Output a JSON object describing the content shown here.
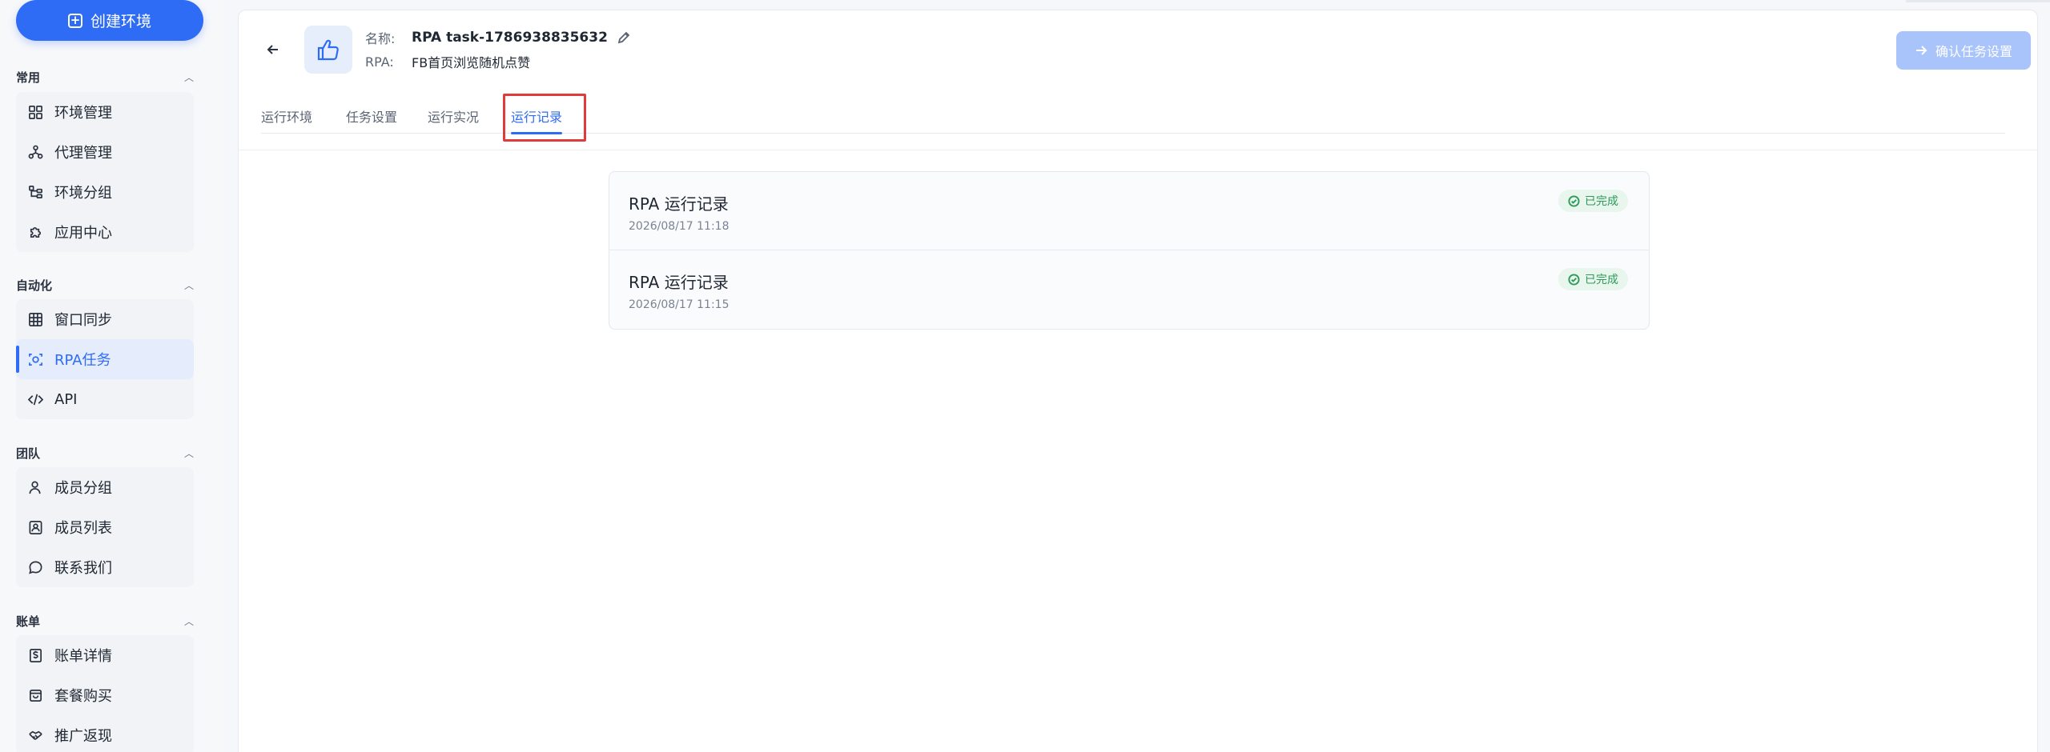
{
  "sidebar": {
    "create_button": "创建环境",
    "groups": [
      {
        "title": "常用",
        "items": [
          {
            "label": "环境管理",
            "icon": "grid-icon"
          },
          {
            "label": "代理管理",
            "icon": "network-icon"
          },
          {
            "label": "环境分组",
            "icon": "tree-icon"
          },
          {
            "label": "应用中心",
            "icon": "puzzle-icon"
          }
        ]
      },
      {
        "title": "自动化",
        "items": [
          {
            "label": "窗口同步",
            "icon": "window-grid-icon"
          },
          {
            "label": "RPA任务",
            "icon": "rpa-icon",
            "active": true
          },
          {
            "label": "API",
            "icon": "code-icon"
          }
        ]
      },
      {
        "title": "团队",
        "items": [
          {
            "label": "成员分组",
            "icon": "user-icon"
          },
          {
            "label": "成员列表",
            "icon": "user-card-icon"
          },
          {
            "label": "联系我们",
            "icon": "chat-icon"
          }
        ]
      },
      {
        "title": "账单",
        "items": [
          {
            "label": "账单详情",
            "icon": "bill-icon"
          },
          {
            "label": "套餐购买",
            "icon": "bag-icon"
          },
          {
            "label": "推广返现",
            "icon": "handshake-icon"
          }
        ]
      }
    ]
  },
  "task": {
    "name_label": "名称:",
    "name_value": "RPA task-1786938835632",
    "rpa_label": "RPA:",
    "rpa_value": "FB首页浏览随机点赞"
  },
  "confirm_button": "确认任务设置",
  "tabs": [
    {
      "label": "运行环境"
    },
    {
      "label": "任务设置"
    },
    {
      "label": "运行实况"
    },
    {
      "label": "运行记录",
      "active": true
    }
  ],
  "records": [
    {
      "title": "RPA 运行记录",
      "time": "2026/08/17 11:18",
      "status": "已完成"
    },
    {
      "title": "RPA 运行记录",
      "time": "2026/08/17 11:15",
      "status": "已完成"
    }
  ],
  "colors": {
    "accent": "#2f6cf6",
    "success": "#2e9a5a",
    "highlight": "#e03a3a"
  }
}
